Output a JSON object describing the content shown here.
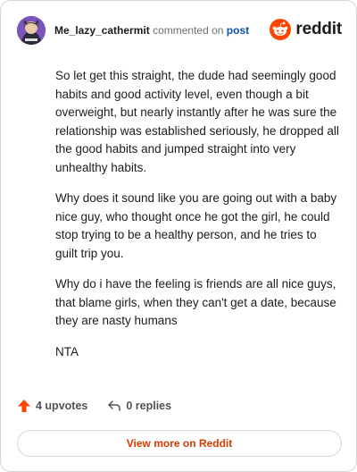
{
  "header": {
    "username": "Me_lazy_cathermit",
    "action_text": "commented on",
    "post_link": "post",
    "brand": "reddit"
  },
  "comment": {
    "paragraphs": [
      "So let get this straight, the dude had seemingly good habits and good activity level, even though a bit overweight, but nearly instantly after he was sure the relationship was established seriously, he dropped all the good habits and jumped straight into very unhealthy habits.",
      "Why does it sound like you are going out with a baby nice guy, who thought once he got the girl, he could stop trying to be a healthy person, and he tries to guilt trip you.",
      "Why do i have the feeling is friends are all nice guys, that blame girls, when they can't get a date, because they are nasty humans",
      "NTA"
    ]
  },
  "actions": {
    "upvotes": "4 upvotes",
    "replies": "0 replies"
  },
  "footer": {
    "view_more": "View more on Reddit"
  },
  "colors": {
    "brand": "#ff4500",
    "link": "#0f4fa8",
    "view_more": "#d93a00"
  },
  "icons": {
    "avatar": "user-avatar",
    "logo": "reddit-snoo-icon",
    "upvote": "upvote-arrow-icon",
    "reply": "reply-arrow-icon"
  }
}
